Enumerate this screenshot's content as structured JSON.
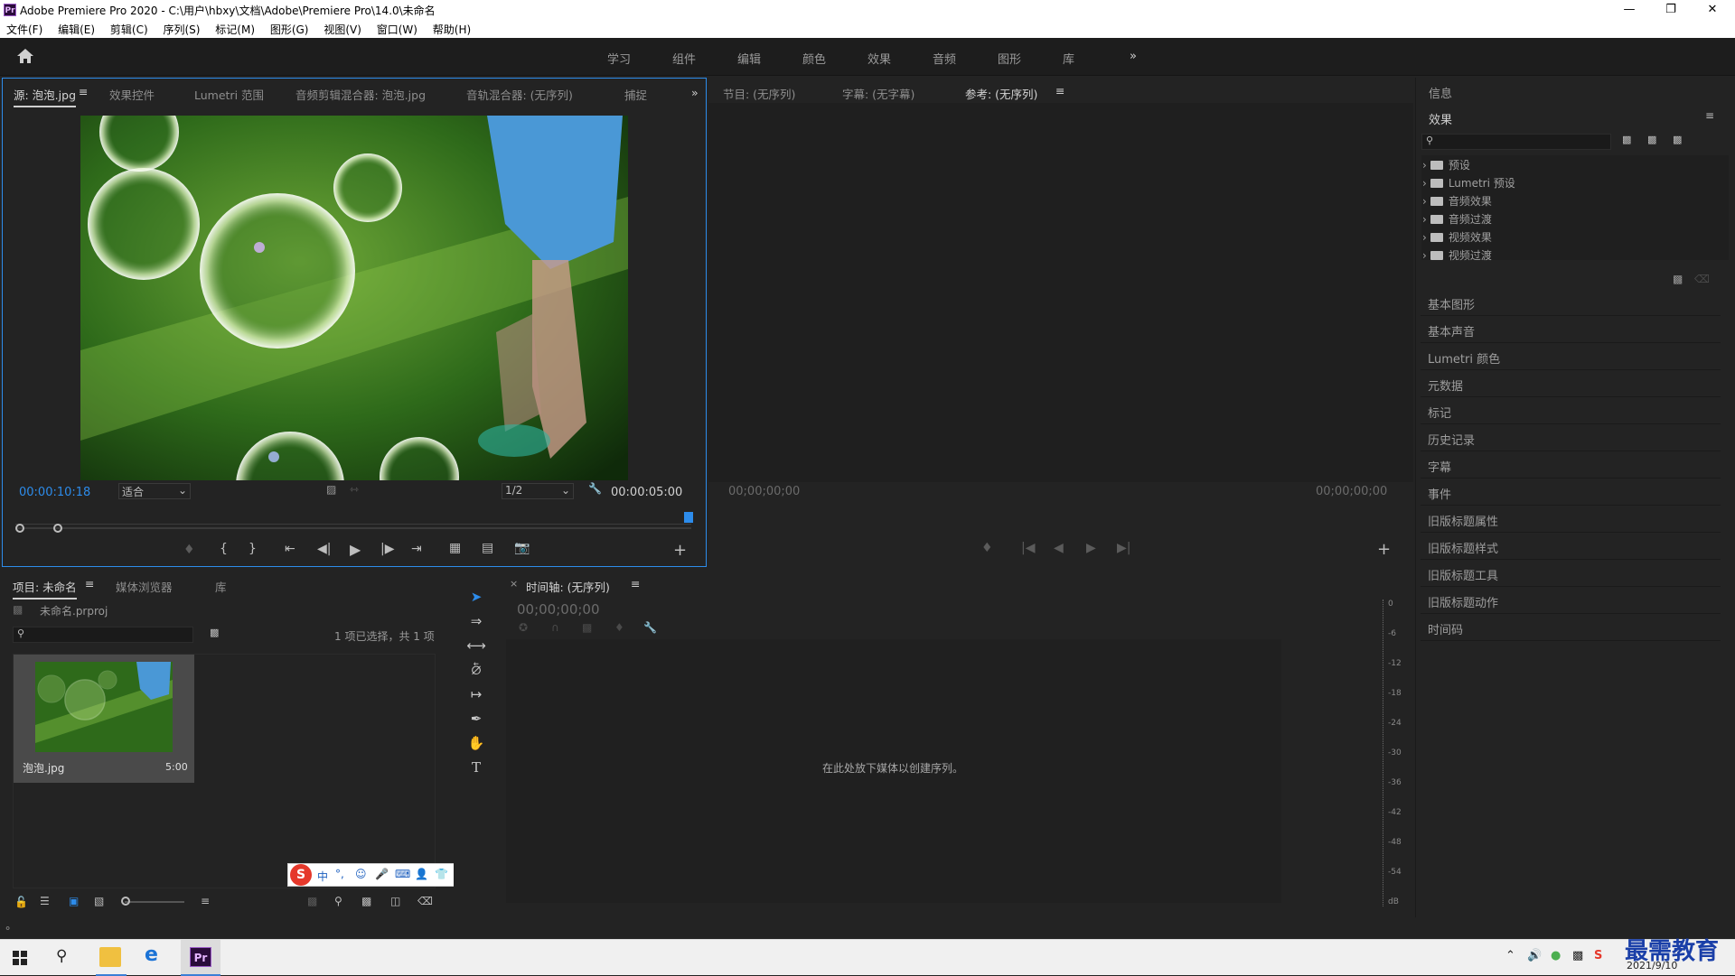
{
  "window": {
    "title": "Adobe Premiere Pro 2020 - C:\\用户\\hbxy\\文档\\Adobe\\Premiere Pro\\14.0\\未命名",
    "app_icon": "Pr"
  },
  "menu": [
    "文件(F)",
    "编辑(E)",
    "剪辑(C)",
    "序列(S)",
    "标记(M)",
    "图形(G)",
    "视图(V)",
    "窗口(W)",
    "帮助(H)"
  ],
  "workspaces": [
    "学习",
    "组件",
    "编辑",
    "颜色",
    "效果",
    "音频",
    "图形",
    "库"
  ],
  "source_panel": {
    "tabs": [
      "源: 泡泡.jpg",
      "效果控件",
      "Lumetri 范围",
      "音频剪辑混合器: 泡泡.jpg",
      "音轨混合器: (无序列)",
      "捕捉"
    ],
    "timecode": "00:00:10:18",
    "fit": "适合",
    "resolution": "1/2",
    "duration": "00:00:05:00"
  },
  "program_panel": {
    "tabs": [
      "节目: (无序列)",
      "字幕: (无字幕)",
      "参考: (无序列)"
    ],
    "timecode_left": "00;00;00;00",
    "timecode_right": "00;00;00;00"
  },
  "right_panel": {
    "info": "信息",
    "effects_title": "效果",
    "effects_tree": [
      "预设",
      "Lumetri 预设",
      "音频效果",
      "音频过渡",
      "视频效果",
      "视频过渡"
    ],
    "items": [
      "基本图形",
      "基本声音",
      "Lumetri 颜色",
      "元数据",
      "标记",
      "历史记录",
      "字幕",
      "事件",
      "旧版标题属性",
      "旧版标题样式",
      "旧版标题工具",
      "旧版标题动作",
      "时间码"
    ]
  },
  "project_panel": {
    "tabs": [
      "项目: 未命名",
      "媒体浏览器",
      "库"
    ],
    "file": "未命名.prproj",
    "selection": "1 项已选择，共 1 项",
    "clip_name": "泡泡.jpg",
    "clip_duration": "5:00"
  },
  "timeline_panel": {
    "tab": "时间轴: (无序列)",
    "timecode": "00;00;00;00",
    "empty_message": "在此处放下媒体以创建序列。"
  },
  "audio_meter": {
    "ticks": [
      "0",
      "-6",
      "-12",
      "-18",
      "-24",
      "-30",
      "-36",
      "-42",
      "-48",
      "-54",
      "dB"
    ]
  },
  "ime_toolbar": [
    "中",
    "°,",
    "☺",
    "🎤",
    "⌨",
    "👤",
    "👕",
    "▦"
  ],
  "taskbar": {
    "date": "2021/9/10",
    "watermark": "最需教育"
  }
}
